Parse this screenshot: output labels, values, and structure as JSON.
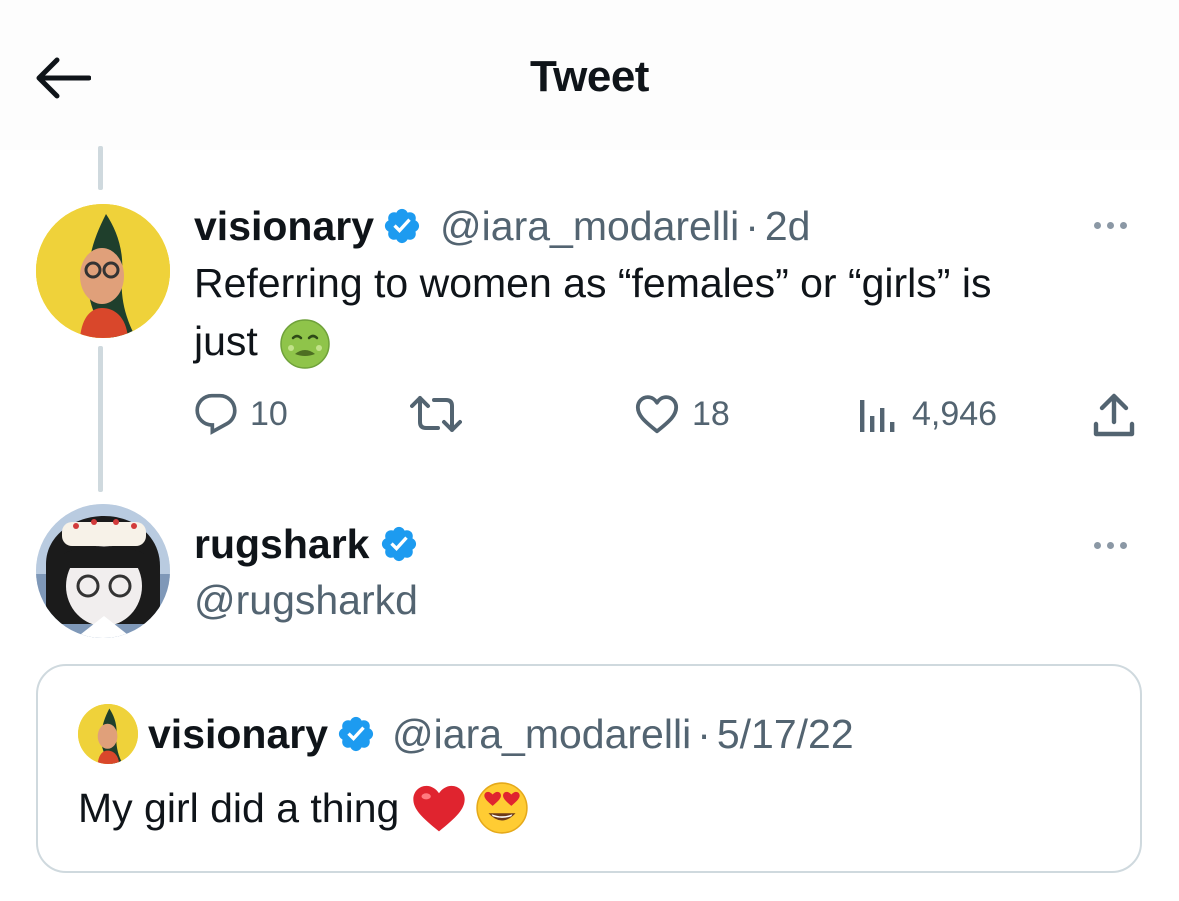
{
  "header": {
    "title": "Tweet",
    "back_icon": "arrow-left-icon"
  },
  "tweet": {
    "author_name": "visionary",
    "handle": "@iara_modarelli",
    "separator": "·",
    "time": "2d",
    "text_line1": "Referring to women as “females” or “girls” is",
    "text_line2": "just",
    "emoji": "nauseated-face-icon",
    "actions": {
      "replies": "10",
      "retweets": "",
      "likes": "18",
      "views": "4,946"
    }
  },
  "reply": {
    "author_name": "rugshark",
    "handle": "@rugsharkd"
  },
  "quote": {
    "author_name": "visionary",
    "handle": "@iara_modarelli",
    "separator": "·",
    "date": "5/17/22",
    "text": "My girl did a thing",
    "emojis": [
      "red-heart-icon",
      "heart-eyes-icon"
    ]
  },
  "colors": {
    "verified": "#1d9bf0",
    "muted": "#536471",
    "border": "#cfd9de"
  }
}
